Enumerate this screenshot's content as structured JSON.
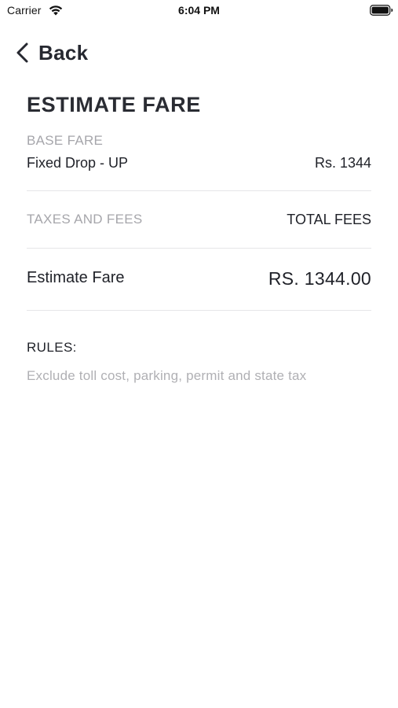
{
  "status_bar": {
    "carrier": "Carrier",
    "time": "6:04 PM",
    "icons": [
      "wifi-icon",
      "battery-icon"
    ]
  },
  "nav": {
    "back_label": "Back",
    "back_icon": "chevron-left-icon"
  },
  "page": {
    "title": "ESTIMATE FARE"
  },
  "base_fare": {
    "label": "BASE FARE",
    "item": "Fixed Drop - UP",
    "amount": "Rs. 1344"
  },
  "taxes": {
    "label": "TAXES AND FEES",
    "value": "TOTAL FEES"
  },
  "estimate": {
    "label": "Estimate Fare",
    "value": "RS. 1344.00"
  },
  "rules": {
    "heading": "RULES:",
    "text": "Exclude toll cost, parking, permit and state tax"
  },
  "colors": {
    "text_primary": "#1f2128",
    "text_muted": "#a6a6ab",
    "divider": "#e6e6e8",
    "background": "#ffffff"
  }
}
